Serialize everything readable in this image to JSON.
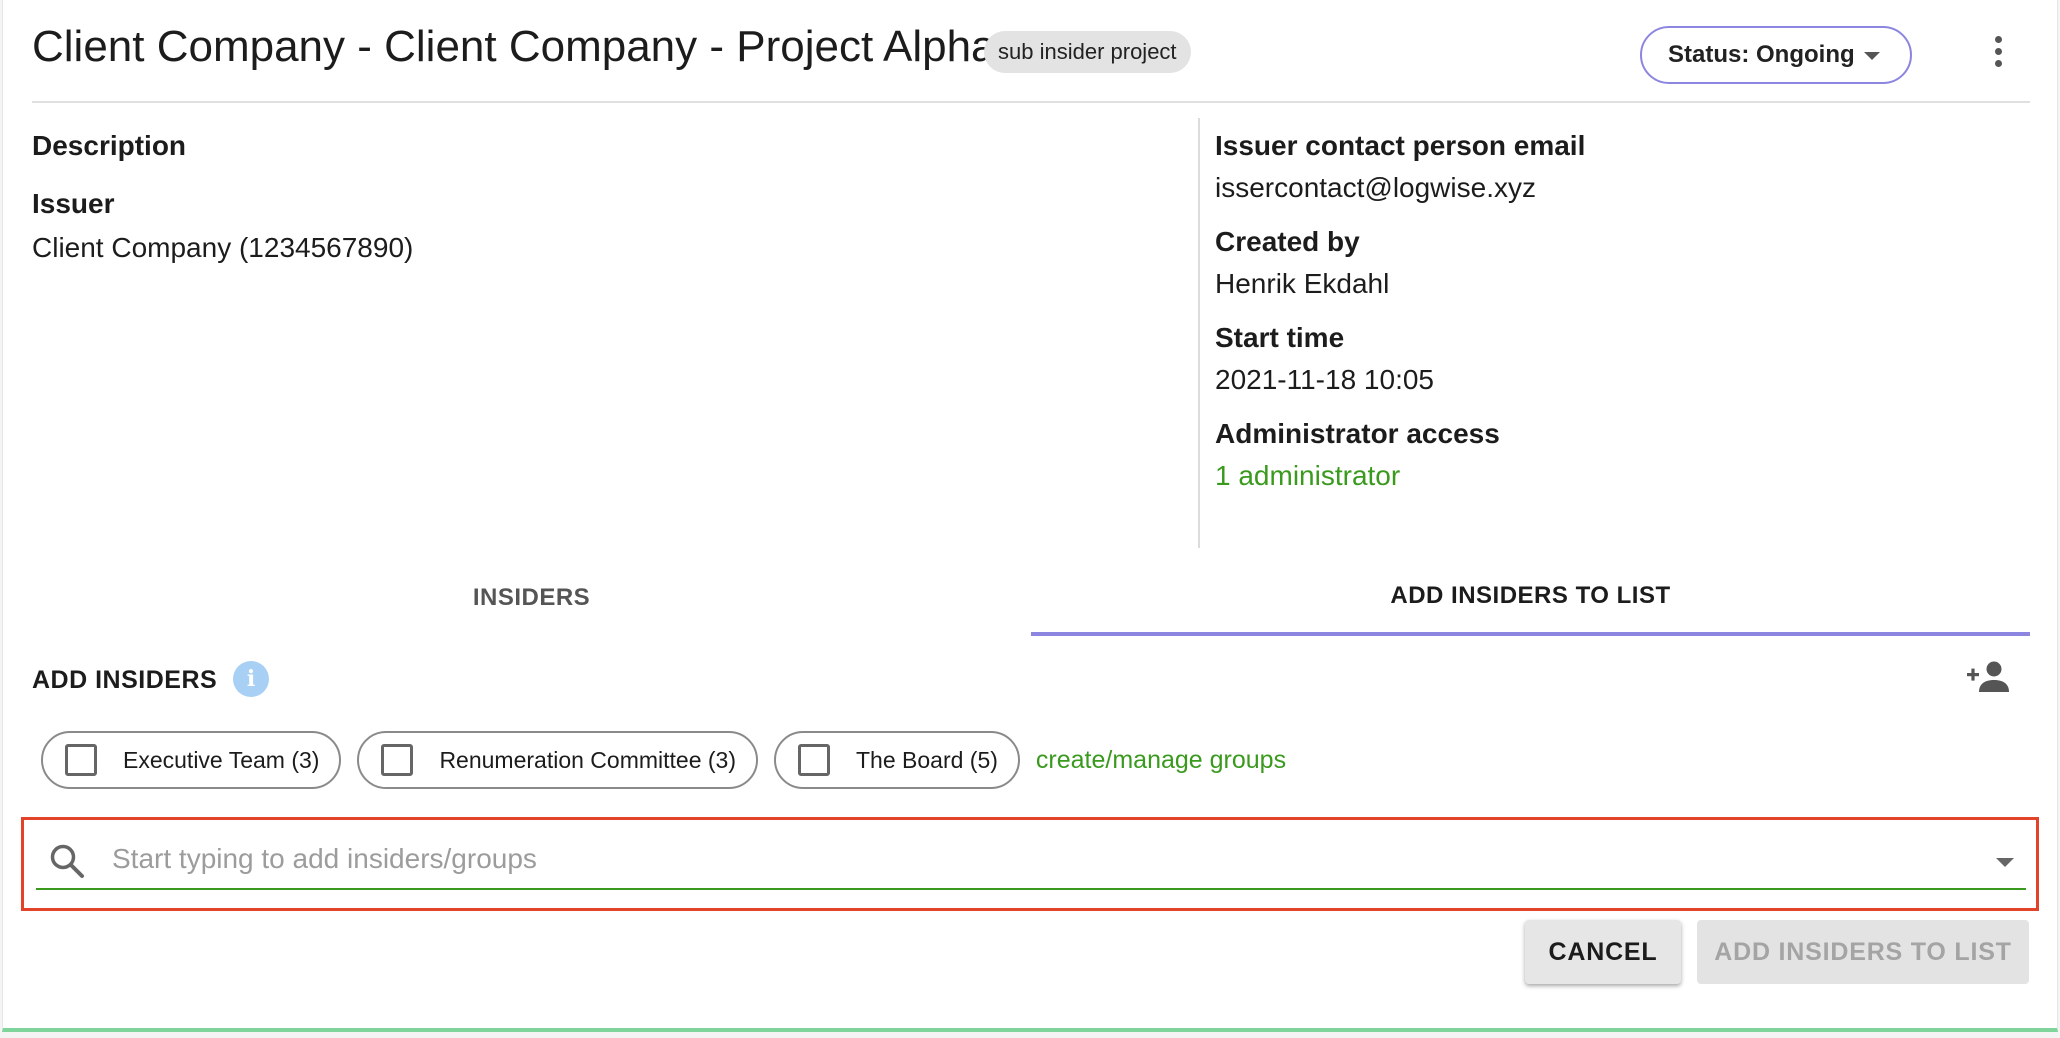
{
  "header": {
    "title": "Client Company - Client Company - Project Alpha",
    "tag": "sub insider project",
    "status_label": "Status: Ongoing"
  },
  "details": {
    "left": [
      {
        "label": "Description",
        "value": ""
      },
      {
        "label": "Issuer",
        "value": "Client Company (1234567890)"
      }
    ],
    "right": [
      {
        "label": "Issuer contact person email",
        "value": "issercontact@logwise.xyz"
      },
      {
        "label": "Created by",
        "value": "Henrik Ekdahl"
      },
      {
        "label": "Start time",
        "value": "2021-11-18 10:05"
      },
      {
        "label": "Administrator access",
        "value": "1 administrator",
        "is_link": true
      }
    ]
  },
  "tabs": [
    {
      "label": "INSIDERS",
      "active": false
    },
    {
      "label": "ADD INSIDERS TO LIST",
      "active": true
    }
  ],
  "add_insiders": {
    "heading": "ADD INSIDERS",
    "groups": [
      {
        "label": "Executive Team (3)",
        "checked": false
      },
      {
        "label": "Renumeration Committee (3)",
        "checked": false
      },
      {
        "label": "The Board (5)",
        "checked": false
      }
    ],
    "manage_link": "create/manage groups",
    "search": {
      "placeholder": "Start typing to add insiders/groups",
      "value": ""
    }
  },
  "actions": {
    "cancel_label": "CANCEL",
    "submit_label": "ADD INSIDERS TO LIST"
  },
  "colors": {
    "accent": "#8d86e0",
    "link_green": "#3a9a1e",
    "highlight_red": "#e2432a",
    "info_blue": "#a8d0f5"
  },
  "icons": [
    "kebab-menu-icon",
    "dropdown-caret-icon",
    "info-icon",
    "person-add-icon",
    "search-icon",
    "checkbox-icon"
  ]
}
